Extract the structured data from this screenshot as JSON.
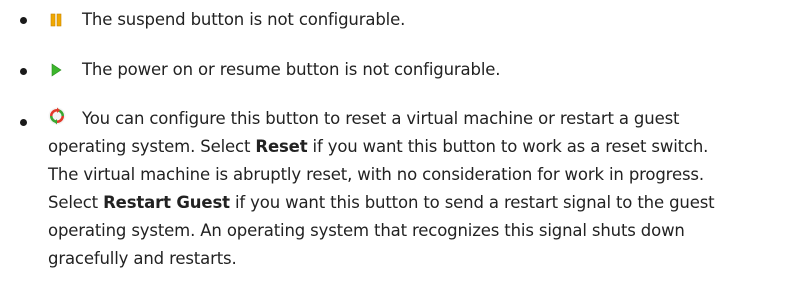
{
  "bullets": [
    {
      "icon": "suspend-icon",
      "text": "The suspend button is not configurable."
    },
    {
      "icon": "power-on-resume-icon",
      "text": "The power on or resume button is not configurable."
    },
    {
      "icon": "reset-restart-icon",
      "line1": "You can configure this button to reset a virtual machine or restart a guest",
      "line2_pre": "operating system. Select ",
      "line2_bold": "Reset",
      "line2_post": " if you want this button to work as a reset switch.",
      "line3": "The virtual machine is abruptly reset, with no consideration for work in progress.",
      "line4_pre": "Select ",
      "line4_bold": "Restart Guest",
      "line4_post": " if you want this button to send a restart signal to the guest",
      "line5": "operating system. An operating system that recognizes this signal shuts down",
      "line6": "gracefully and restarts."
    }
  ],
  "colors": {
    "text": "#222222",
    "suspend": "#f0a800",
    "play": "#3cb62c",
    "reset_red": "#e23a2a",
    "reset_green": "#3aa832"
  }
}
